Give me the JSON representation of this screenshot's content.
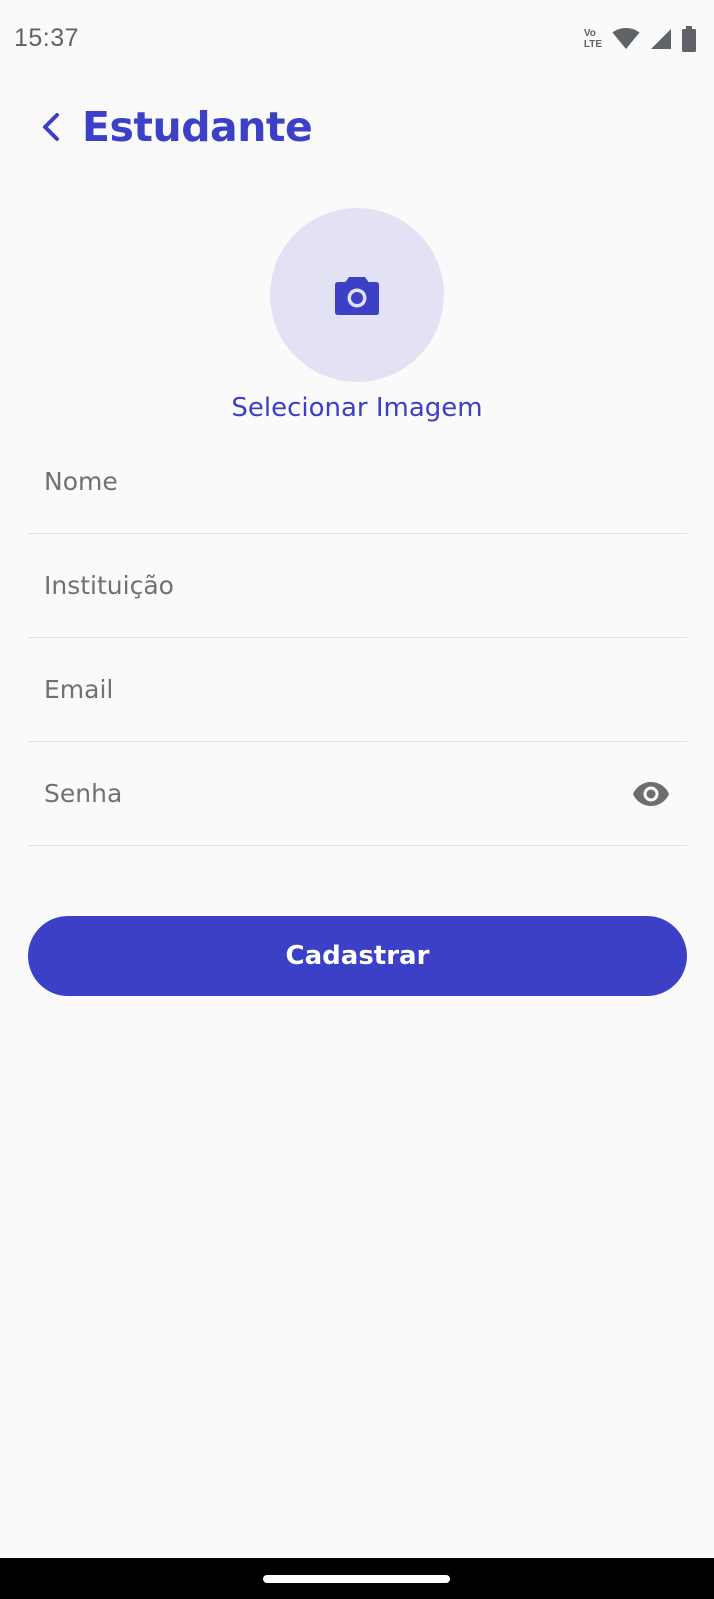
{
  "status_bar": {
    "time": "15:37",
    "volte_top": "Vo",
    "volte_bottom": "LTE",
    "icons": [
      "volte-icon",
      "wifi-icon",
      "cell-signal-icon",
      "battery-icon"
    ]
  },
  "header": {
    "title": "Estudante",
    "back_icon": "chevron-left-icon"
  },
  "avatar": {
    "icon": "camera-icon",
    "select_label": "Selecionar Imagem"
  },
  "form": {
    "fields": [
      {
        "name": "nome",
        "placeholder": "Nome",
        "value": ""
      },
      {
        "name": "instituicao",
        "placeholder": "Instituição",
        "value": ""
      },
      {
        "name": "email",
        "placeholder": "Email",
        "value": ""
      },
      {
        "name": "senha",
        "placeholder": "Senha",
        "value": "",
        "toggle_icon": "eye-icon"
      }
    ],
    "submit_label": "Cadastrar"
  },
  "colors": {
    "accent": "#3b40c6",
    "avatar_bg": "#e3e2f4",
    "background": "#fafafa",
    "placeholder": "#717171",
    "divider": "#e0e0e0"
  }
}
